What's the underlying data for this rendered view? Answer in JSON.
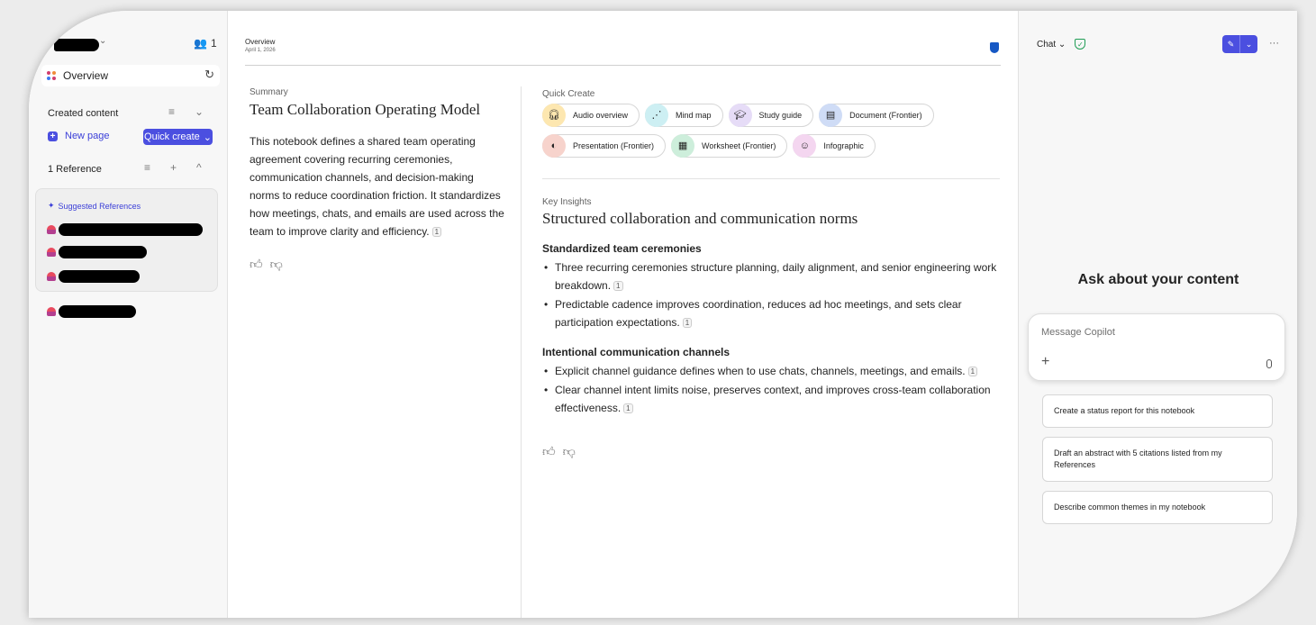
{
  "sidebar": {
    "share_count": "1",
    "overview_label": "Overview",
    "created_content_label": "Created content",
    "new_page_label": "New page",
    "quick_create_label": "Quick create",
    "references_label": "1 Reference",
    "suggested_references_label": "Suggested References"
  },
  "header": {
    "title": "Overview",
    "date": "April 1, 2026"
  },
  "summary": {
    "label": "Summary",
    "title": "Team Collaboration Operating Model",
    "body": "This notebook defines a shared team operating agreement covering recurring ceremonies, communication channels, and decision-making norms to reduce coordination friction. It standardizes how meetings, chats, and emails are used across the team to improve clarity and efficiency.",
    "citation": "1"
  },
  "quick_create": {
    "label": "Quick Create",
    "items": [
      {
        "label": "Audio overview",
        "icon": "headphones-icon",
        "color": "#fde7b0"
      },
      {
        "label": "Mind map",
        "icon": "mind-map-icon",
        "color": "#cdeff3"
      },
      {
        "label": "Study guide",
        "icon": "graduation-cap-icon",
        "color": "#e6dcf7"
      },
      {
        "label": "Document (Frontier)",
        "icon": "word-doc-icon",
        "color": "#cfdcf6"
      },
      {
        "label": "Presentation (Frontier)",
        "icon": "powerpoint-icon",
        "color": "#f7d3cc"
      },
      {
        "label": "Worksheet (Frontier)",
        "icon": "excel-icon",
        "color": "#cdeedb"
      },
      {
        "label": "Infographic",
        "icon": "infographic-icon",
        "color": "#f4d6f0"
      }
    ]
  },
  "insights": {
    "label": "Key Insights",
    "title": "Structured collaboration and communication norms",
    "sections": [
      {
        "heading": "Standardized team ceremonies",
        "bullets": [
          "Three recurring ceremonies structure planning, daily alignment, and senior engineering work breakdown.",
          "Predictable cadence improves coordination, reduces ad hoc meetings, and sets clear participation expectations."
        ]
      },
      {
        "heading": "Intentional communication channels",
        "bullets": [
          "Explicit channel guidance defines when to use chats, channels, meetings, and emails.",
          "Clear channel intent limits noise, preserves context, and improves cross-team collaboration effectiveness."
        ]
      }
    ],
    "citation": "1"
  },
  "chat": {
    "mode_label": "Chat",
    "heading": "Ask about your content",
    "input_placeholder": "Message Copilot",
    "suggestions": [
      "Create a status report for this notebook",
      "Draft an abstract with 5 citations listed from my References",
      "Describe common themes in my notebook"
    ]
  },
  "colors": {
    "accent": "#4b4fe0",
    "shield": "#1658c4"
  }
}
